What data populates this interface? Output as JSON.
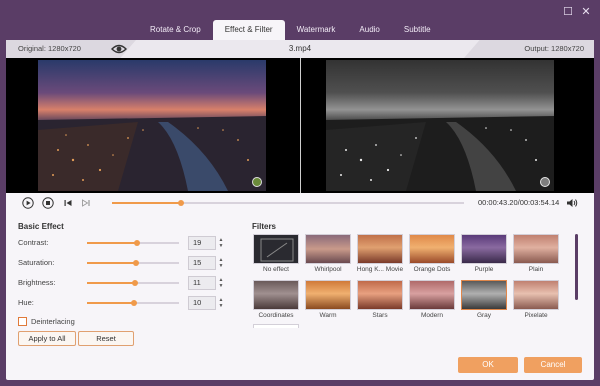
{
  "tabs": [
    "Rotate & Crop",
    "Effect & Filter",
    "Watermark",
    "Audio",
    "Subtitle"
  ],
  "active_tab": "Effect & Filter",
  "window_controls": {
    "maximize": "☐",
    "close": "✕"
  },
  "info": {
    "original": "Original: 1280x720",
    "filename": "3.mp4",
    "output": "Output: 1280x720"
  },
  "playback": {
    "time": "00:00:43.20/00:03:54.14",
    "progress": 0.196
  },
  "basic_effect": {
    "title": "Basic Effect",
    "adjustments": [
      {
        "label": "Contrast:",
        "value": "19",
        "level": 0.54
      },
      {
        "label": "Saturation:",
        "value": "15",
        "level": 0.53
      },
      {
        "label": "Brightness:",
        "value": "11",
        "level": 0.52
      },
      {
        "label": "Hue:",
        "value": "10",
        "level": 0.51
      }
    ],
    "deinterlacing": "Deinterlacing",
    "apply_all": "Apply to All",
    "reset": "Reset"
  },
  "filters": {
    "title": "Filters",
    "items": [
      {
        "name": "No effect"
      },
      {
        "name": "Whirlpool"
      },
      {
        "name": "Hong K... Movie"
      },
      {
        "name": "Orange Dots"
      },
      {
        "name": "Purple"
      },
      {
        "name": "Plain"
      },
      {
        "name": "Coordinates"
      },
      {
        "name": "Warm"
      },
      {
        "name": "Stars"
      },
      {
        "name": "Modern"
      },
      {
        "name": "Gray"
      },
      {
        "name": "Pixelate"
      }
    ],
    "selected": "Gray"
  },
  "footer": {
    "ok": "OK",
    "cancel": "Cancel"
  },
  "colors": {
    "accent": "#f09a4a",
    "titlebar": "#5a3d66",
    "panel": "#f7f5f9"
  }
}
